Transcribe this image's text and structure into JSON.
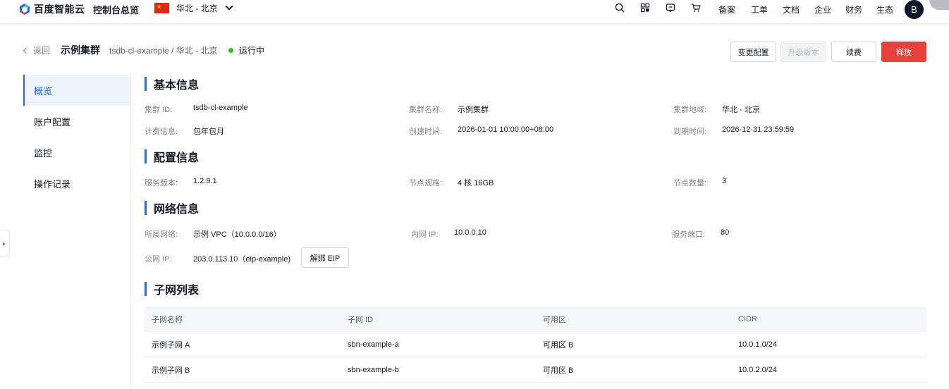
{
  "topbar": {
    "logo_text": "百度智能云",
    "console_label": "控制台总览",
    "region": "华北 - 北京",
    "links": [
      "备案",
      "工单",
      "文档",
      "企业",
      "财务",
      "生态"
    ],
    "avatar_initial": "B"
  },
  "header": {
    "back_label": "返回",
    "title": "示例集群",
    "subtitle": "tsdb-cl-example / 华北 - 北京",
    "status": "运行中",
    "status_color": "#30bf13",
    "buttons": {
      "change_config": "变更配置",
      "upgrade": "升级版本",
      "renew": "续费",
      "release": "释放"
    }
  },
  "sidebar": {
    "items": [
      {
        "label": "概览",
        "active": true
      },
      {
        "label": "账户配置",
        "active": false
      },
      {
        "label": "监控",
        "active": false
      },
      {
        "label": "操作记录",
        "active": false
      }
    ]
  },
  "basic": {
    "title": "基本信息",
    "cluster_id_k": "集群 ID:",
    "cluster_id_v": "tsdb-cl-example",
    "cluster_name_k": "集群名称:",
    "cluster_name_v": "示例集群",
    "region_k": "集群地域:",
    "region_v": "华北 - 北京",
    "billing_k": "计费信息:",
    "billing_v": "包年包月",
    "created_k": "创建时间:",
    "created_v": "2026-01-01 10:00:00+08:00",
    "expire_k": "到期时间:",
    "expire_v": "2026-12-31 23:59:59"
  },
  "config": {
    "title": "配置信息",
    "version_k": "服务版本:",
    "version_v": "1.2.9.1",
    "spec_k": "节点规格:",
    "spec_v": "4 核 16GB",
    "count_k": "节点数量:",
    "count_v": "3"
  },
  "network": {
    "title": "网络信息",
    "vpc_k": "所属网络:",
    "vpc_v": "示例 VPC（10.0.0.0/16）",
    "inner_ip_k": "内网 IP:",
    "inner_ip_v": "10.0.0.10",
    "port_k": "服务端口:",
    "port_v": "80",
    "public_ip_k": "公网 IP:",
    "public_ip_v": "203.0.113.10（eip-example)",
    "unbind_label": "解绑 EIP"
  },
  "subnets": {
    "title": "子网列表",
    "columns": [
      "子网名称",
      "子网 ID",
      "可用区",
      "CIDR"
    ],
    "rows": [
      [
        "示例子网 A",
        "sbn-example-a",
        "可用区 B",
        "10.0.1.0/24"
      ],
      [
        "示例子网 B",
        "sbn-example-b",
        "可用区 B",
        "10.0.2.0/24"
      ]
    ]
  },
  "accent_color": "#2468f2",
  "danger_color": "#e8403b"
}
